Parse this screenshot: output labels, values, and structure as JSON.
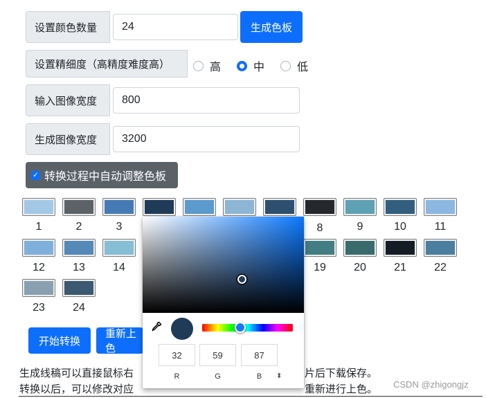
{
  "settings": {
    "color_count_label": "设置颜色数量",
    "color_count_value": "24",
    "generate_palette_button": "生成色板",
    "precision_label": "设置精细度（高精度难度高）",
    "precision_options": [
      {
        "label": "高",
        "checked": false
      },
      {
        "label": "中",
        "checked": true
      },
      {
        "label": "低",
        "checked": false
      }
    ],
    "input_width_label": "输入图像宽度",
    "input_width_value": "800",
    "output_width_label": "生成图像宽度",
    "output_width_value": "3200",
    "auto_adjust_label": "转换过程中自动调整色板",
    "auto_adjust_checked": true
  },
  "palette": [
    {
      "n": "1",
      "color": "#a3c8e6"
    },
    {
      "n": "2",
      "color": "#5c6368"
    },
    {
      "n": "3",
      "color": "#467ab5"
    },
    {
      "n": "4",
      "color": "#203b57"
    },
    {
      "n": "5",
      "color": "#5b9acc"
    },
    {
      "n": "6",
      "color": "#8cb6d4"
    },
    {
      "n": "7",
      "color": "#2e4f70"
    },
    {
      "n": "8",
      "color": "#25292d"
    },
    {
      "n": "9",
      "color": "#5ea1b4"
    },
    {
      "n": "10",
      "color": "#325f7d"
    },
    {
      "n": "11",
      "color": "#8bb7e0"
    },
    {
      "n": "12",
      "color": "#7fb0dc"
    },
    {
      "n": "13",
      "color": "#5489b8"
    },
    {
      "n": "14",
      "color": "#86bed6"
    },
    {
      "n": "19",
      "color": "#417d82"
    },
    {
      "n": "20",
      "color": "#3a6b6c"
    },
    {
      "n": "21",
      "color": "#141d26"
    },
    {
      "n": "22",
      "color": "#4c7e9f"
    },
    {
      "n": "23",
      "color": "#8a9fb0"
    },
    {
      "n": "24",
      "color": "#3b5970"
    }
  ],
  "actions": {
    "start_convert": "开始转换",
    "recolor_partial": "重新上色"
  },
  "color_picker": {
    "r": "32",
    "g": "59",
    "b": "87",
    "r_label": "R",
    "g_label": "G",
    "b_label": "B",
    "toggle_symbol": "⬍",
    "preview_color": "#203b57"
  },
  "help_text": {
    "line1_left": "生成线稿可以直接鼠标右",
    "line1_right": "或图片后下载保存。",
    "line2_left": "转换以后，可以修改对应",
    "line2_right": "重新进行上色。"
  },
  "watermark": "CSDN @zhigongjz",
  "icons": {
    "eyedropper": "eyedropper-icon",
    "checkbox": "checkmark-icon",
    "toggle": "up-down-arrows-icon"
  }
}
